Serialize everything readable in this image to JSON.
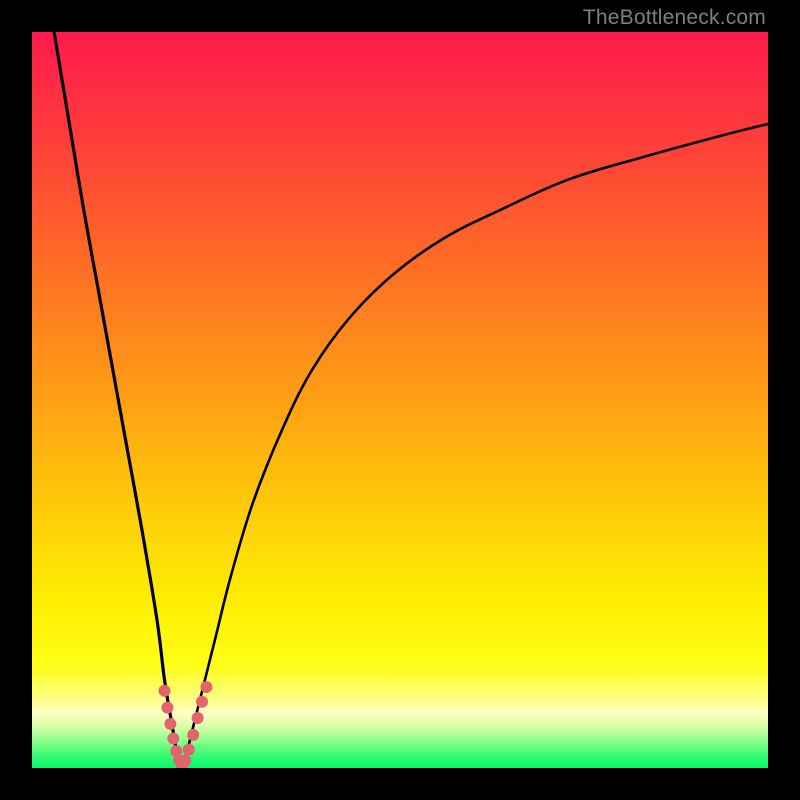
{
  "watermark": "TheBottleneck.com",
  "colors": {
    "frame": "#000000",
    "curve": "#000000",
    "marker": "#e2656e",
    "gradient_stops": [
      {
        "offset": 0.0,
        "color": "#fe1a4c"
      },
      {
        "offset": 0.16,
        "color": "#fe4138"
      },
      {
        "offset": 0.34,
        "color": "#fe7322"
      },
      {
        "offset": 0.5,
        "color": "#fea014"
      },
      {
        "offset": 0.66,
        "color": "#fecf08"
      },
      {
        "offset": 0.78,
        "color": "#feef02"
      },
      {
        "offset": 0.86,
        "color": "#fefe16"
      },
      {
        "offset": 0.905,
        "color": "#feff82"
      },
      {
        "offset": 0.925,
        "color": "#fdffc4"
      },
      {
        "offset": 0.945,
        "color": "#d6ffa6"
      },
      {
        "offset": 0.965,
        "color": "#85fd8b"
      },
      {
        "offset": 0.985,
        "color": "#2efa72"
      },
      {
        "offset": 1.0,
        "color": "#07f868"
      }
    ]
  },
  "chart_data": {
    "type": "line",
    "title": "",
    "xlabel": "",
    "ylabel": "",
    "xlim": [
      0,
      100
    ],
    "ylim": [
      0,
      100
    ],
    "grid": false,
    "series": [
      {
        "name": "left-branch",
        "x": [
          3,
          5,
          7,
          9,
          11,
          13,
          15,
          17,
          18,
          19,
          19.7,
          20.3
        ],
        "y": [
          100,
          88,
          76,
          65,
          54,
          43,
          32,
          20,
          12,
          6,
          2,
          0
        ]
      },
      {
        "name": "right-branch",
        "x": [
          20.3,
          21,
          22,
          23.5,
          25,
          27,
          30,
          34,
          38,
          43,
          49,
          56,
          64,
          73,
          83,
          94,
          100
        ],
        "y": [
          0,
          2,
          6,
          12,
          18,
          26,
          36,
          46,
          54,
          61,
          67,
          72,
          76,
          80,
          83,
          86,
          87.5
        ]
      }
    ],
    "markers": {
      "name": "valley-markers",
      "color": "#e2656e",
      "radius_px": 6,
      "points": [
        {
          "x": 18.0,
          "y": 10.5
        },
        {
          "x": 18.4,
          "y": 8.2
        },
        {
          "x": 18.8,
          "y": 6.0
        },
        {
          "x": 19.2,
          "y": 4.0
        },
        {
          "x": 19.6,
          "y": 2.3
        },
        {
          "x": 20.0,
          "y": 1.0
        },
        {
          "x": 20.4,
          "y": 0.4
        },
        {
          "x": 20.8,
          "y": 1.0
        },
        {
          "x": 21.3,
          "y": 2.5
        },
        {
          "x": 21.9,
          "y": 4.5
        },
        {
          "x": 22.5,
          "y": 6.8
        },
        {
          "x": 23.1,
          "y": 9.0
        },
        {
          "x": 23.7,
          "y": 11.0
        }
      ]
    },
    "optimal_zone_y": [
      0,
      9
    ],
    "annotations": []
  }
}
